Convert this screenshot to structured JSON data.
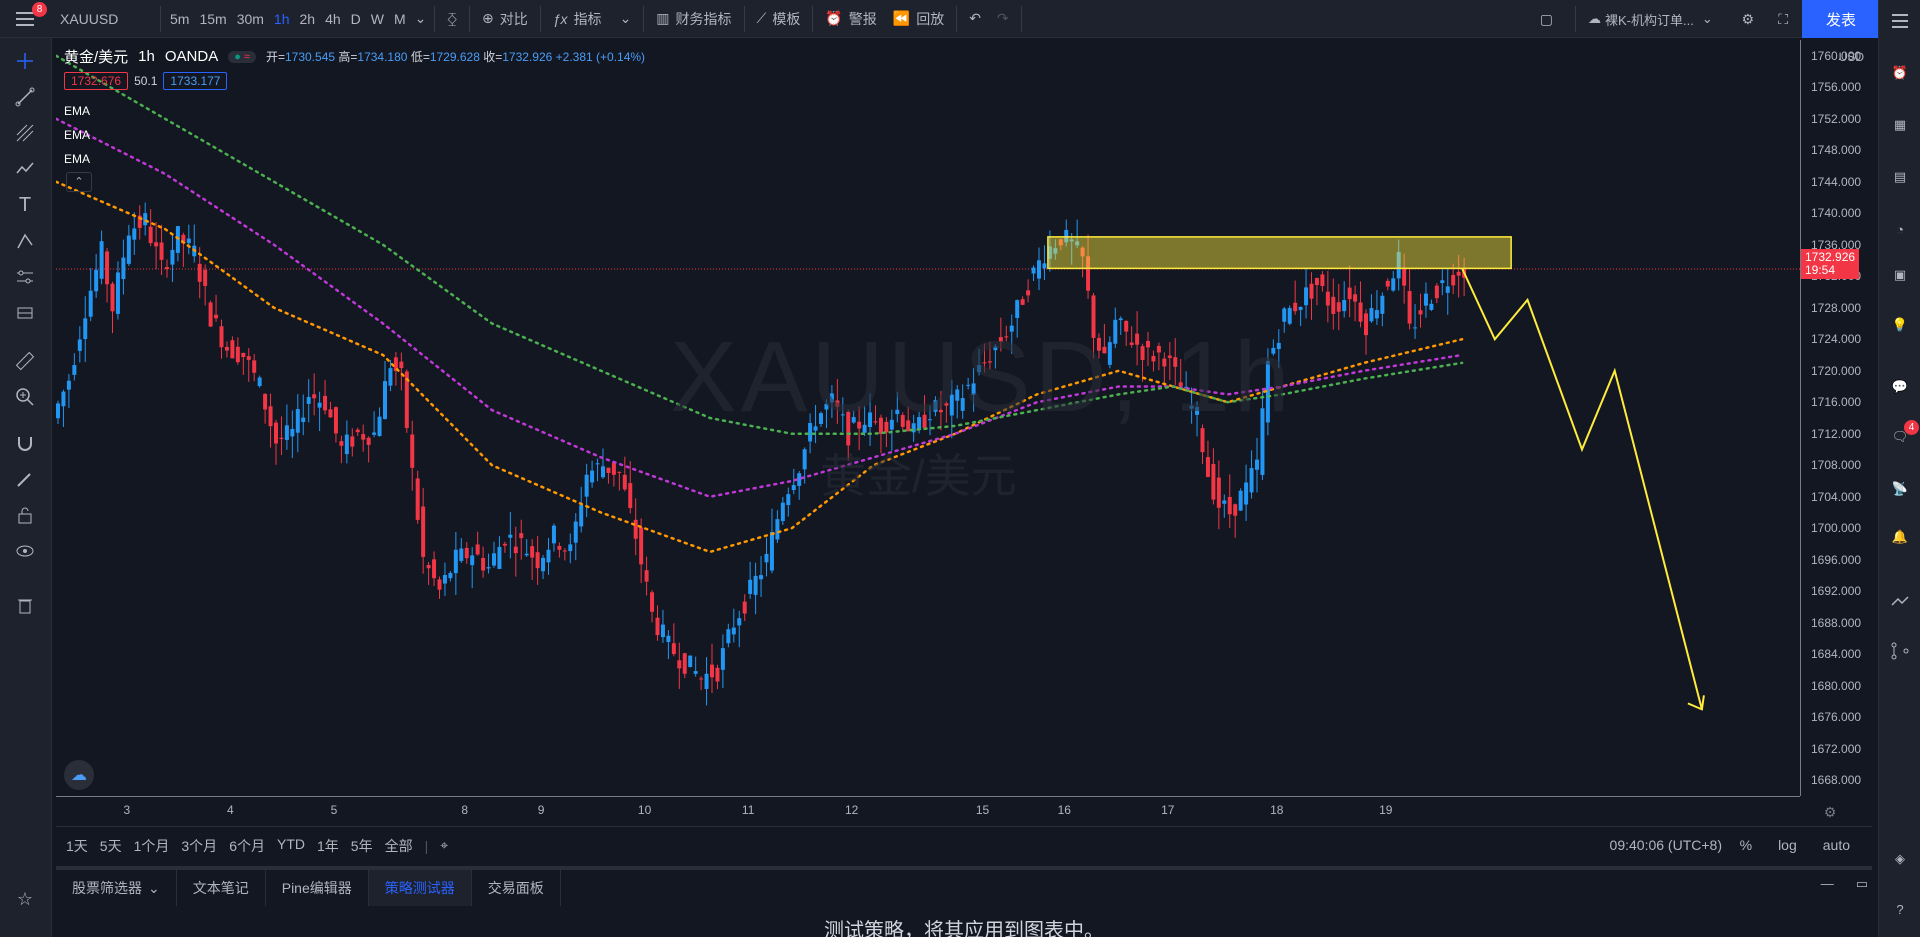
{
  "topbar": {
    "notification_count": "8",
    "symbol": "XAUUSD",
    "intervals": [
      "5m",
      "15m",
      "30m",
      "1h",
      "2h",
      "4h",
      "D",
      "W",
      "M"
    ],
    "active_interval": "1h",
    "compare_label": "对比",
    "indicators_label": "指标",
    "financials_label": "财务指标",
    "templates_label": "模板",
    "alert_label": "警报",
    "replay_label": "回放",
    "layout_name": "裸K-机构订单...",
    "publish_label": "发表"
  },
  "legend": {
    "title": "黄金/美元",
    "interval": "1h",
    "source": "OANDA",
    "open_label": "开=",
    "open": "1730.545",
    "high_label": "高=",
    "high": "1734.180",
    "low_label": "低=",
    "low": "1729.628",
    "close_label": "收=",
    "close": "1732.926",
    "change": "+2.381 (+0.14%)",
    "bid": "1732.676",
    "spread": "50.1",
    "ask": "1733.177"
  },
  "indicators": [
    {
      "name": "EMA",
      "color": "#ff9800"
    },
    {
      "name": "EMA",
      "color": "#c038d8"
    },
    {
      "name": "EMA",
      "color": "#4caf50"
    }
  ],
  "watermark": {
    "symbol": "XAUUSD, 1h",
    "description": "黄金/美元"
  },
  "price_axis": {
    "currency": "USD",
    "labels": [
      "1760.000",
      "1756.000",
      "1752.000",
      "1748.000",
      "1744.000",
      "1740.000",
      "1736.000",
      "1732.000",
      "1728.000",
      "1724.000",
      "1720.000",
      "1716.000",
      "1712.000",
      "1708.000",
      "1704.000",
      "1700.000",
      "1696.000",
      "1692.000",
      "1688.000",
      "1684.000",
      "1680.000",
      "1676.000",
      "1672.000",
      "1668.000"
    ],
    "current_price": "1732.926",
    "countdown": "19:54"
  },
  "time_axis": {
    "labels": [
      "3",
      "4",
      "5",
      "8",
      "9",
      "10",
      "11",
      "12",
      "15",
      "16",
      "17",
      "18",
      "19"
    ]
  },
  "range_bar": {
    "ranges": [
      "1天",
      "5天",
      "1个月",
      "3个月",
      "6个月",
      "YTD",
      "1年",
      "5年",
      "全部"
    ],
    "clock": "09:40:06 (UTC+8)",
    "percent": "%",
    "log": "log",
    "auto": "auto"
  },
  "bottom_panel": {
    "tabs": [
      "股票筛选器",
      "文本笔记",
      "Pine编辑器",
      "策略测试器",
      "交易面板"
    ],
    "active_tab": "策略测试器",
    "message": "测试策略，将其应用到图表中。"
  },
  "rightbar": {
    "notification_count": "4"
  },
  "chart_data": {
    "type": "candlestick",
    "symbol": "XAUUSD",
    "interval": "1h",
    "ylim": [
      1666,
      1762
    ],
    "x_ticks": [
      "3",
      "4",
      "5",
      "8",
      "9",
      "10",
      "11",
      "12",
      "15",
      "16",
      "17",
      "18",
      "19"
    ],
    "price_path": [
      [
        0,
        1714
      ],
      [
        3,
        1719
      ],
      [
        6,
        1728
      ],
      [
        9,
        1735
      ],
      [
        11,
        1728
      ],
      [
        14,
        1738
      ],
      [
        17,
        1739
      ],
      [
        20,
        1733
      ],
      [
        23,
        1737
      ],
      [
        26,
        1735
      ],
      [
        29,
        1727
      ],
      [
        32,
        1723
      ],
      [
        35,
        1722
      ],
      [
        38,
        1718
      ],
      [
        41,
        1711
      ],
      [
        44,
        1712
      ],
      [
        47,
        1717
      ],
      [
        50,
        1716
      ],
      [
        53,
        1710
      ],
      [
        56,
        1712
      ],
      [
        59,
        1712
      ],
      [
        62,
        1721
      ],
      [
        64,
        1719
      ],
      [
        66,
        1707
      ],
      [
        68,
        1696
      ],
      [
        71,
        1692
      ],
      [
        74,
        1696
      ],
      [
        77,
        1697
      ],
      [
        80,
        1695
      ],
      [
        83,
        1699
      ],
      [
        86,
        1698
      ],
      [
        89,
        1696
      ],
      [
        92,
        1699
      ],
      [
        95,
        1697
      ],
      [
        98,
        1707
      ],
      [
        101,
        1708
      ],
      [
        104,
        1707
      ],
      [
        107,
        1699
      ],
      [
        110,
        1689
      ],
      [
        113,
        1685
      ],
      [
        116,
        1683
      ],
      [
        119,
        1681
      ],
      [
        122,
        1682
      ],
      [
        125,
        1688
      ],
      [
        128,
        1692
      ],
      [
        131,
        1696
      ],
      [
        134,
        1704
      ],
      [
        137,
        1708
      ],
      [
        140,
        1714
      ],
      [
        143,
        1716
      ],
      [
        146,
        1712
      ],
      [
        149,
        1714
      ],
      [
        152,
        1713
      ],
      [
        155,
        1715
      ],
      [
        158,
        1712
      ],
      [
        161,
        1715
      ],
      [
        164,
        1715
      ],
      [
        167,
        1717
      ],
      [
        170,
        1720
      ],
      [
        173,
        1723
      ],
      [
        176,
        1726
      ],
      [
        179,
        1731
      ],
      [
        182,
        1735
      ],
      [
        185,
        1737
      ],
      [
        187,
        1736
      ],
      [
        189,
        1734
      ],
      [
        191,
        1725
      ],
      [
        193,
        1721
      ],
      [
        195,
        1726
      ],
      [
        198,
        1724
      ],
      [
        201,
        1722
      ],
      [
        204,
        1722
      ],
      [
        207,
        1718
      ],
      [
        210,
        1714
      ],
      [
        212,
        1707
      ],
      [
        214,
        1703
      ],
      [
        216,
        1702
      ],
      [
        219,
        1705
      ],
      [
        221,
        1708
      ],
      [
        223,
        1721
      ],
      [
        226,
        1727
      ],
      [
        229,
        1729
      ],
      [
        232,
        1731
      ],
      [
        235,
        1728
      ],
      [
        238,
        1730
      ],
      [
        241,
        1726
      ],
      [
        244,
        1730
      ],
      [
        247,
        1734
      ],
      [
        249,
        1725
      ],
      [
        252,
        1729
      ],
      [
        255,
        1731
      ],
      [
        258,
        1733
      ]
    ],
    "ema_fast": [
      [
        0,
        1744
      ],
      [
        20,
        1738
      ],
      [
        40,
        1728
      ],
      [
        60,
        1722
      ],
      [
        80,
        1708
      ],
      [
        100,
        1702
      ],
      [
        120,
        1697
      ],
      [
        135,
        1700
      ],
      [
        150,
        1708
      ],
      [
        165,
        1712
      ],
      [
        180,
        1717
      ],
      [
        195,
        1720
      ],
      [
        205,
        1718
      ],
      [
        215,
        1716
      ],
      [
        225,
        1718
      ],
      [
        240,
        1721
      ],
      [
        258,
        1724
      ]
    ],
    "ema_mid": [
      [
        0,
        1752
      ],
      [
        20,
        1745
      ],
      [
        40,
        1736
      ],
      [
        60,
        1726
      ],
      [
        80,
        1715
      ],
      [
        100,
        1709
      ],
      [
        120,
        1704
      ],
      [
        135,
        1706
      ],
      [
        150,
        1709
      ],
      [
        165,
        1712
      ],
      [
        180,
        1716
      ],
      [
        195,
        1718
      ],
      [
        205,
        1718
      ],
      [
        215,
        1717
      ],
      [
        225,
        1718
      ],
      [
        240,
        1720
      ],
      [
        258,
        1722
      ]
    ],
    "ema_slow": [
      [
        0,
        1760
      ],
      [
        20,
        1752
      ],
      [
        40,
        1744
      ],
      [
        60,
        1736
      ],
      [
        80,
        1726
      ],
      [
        100,
        1720
      ],
      [
        120,
        1714
      ],
      [
        135,
        1712
      ],
      [
        150,
        1712
      ],
      [
        165,
        1713
      ],
      [
        180,
        1715
      ],
      [
        195,
        1717
      ],
      [
        205,
        1718
      ],
      [
        215,
        1716
      ],
      [
        225,
        1717
      ],
      [
        240,
        1719
      ],
      [
        258,
        1721
      ]
    ],
    "resistance_zone": {
      "x_from": 182,
      "x_to": 267,
      "y_from": 1733,
      "y_to": 1737
    },
    "forecast_path": [
      [
        258,
        1733
      ],
      [
        264,
        1724
      ],
      [
        270,
        1729
      ],
      [
        280,
        1710
      ],
      [
        286,
        1720
      ],
      [
        302,
        1677
      ]
    ],
    "current_price_line": 1732.926
  }
}
